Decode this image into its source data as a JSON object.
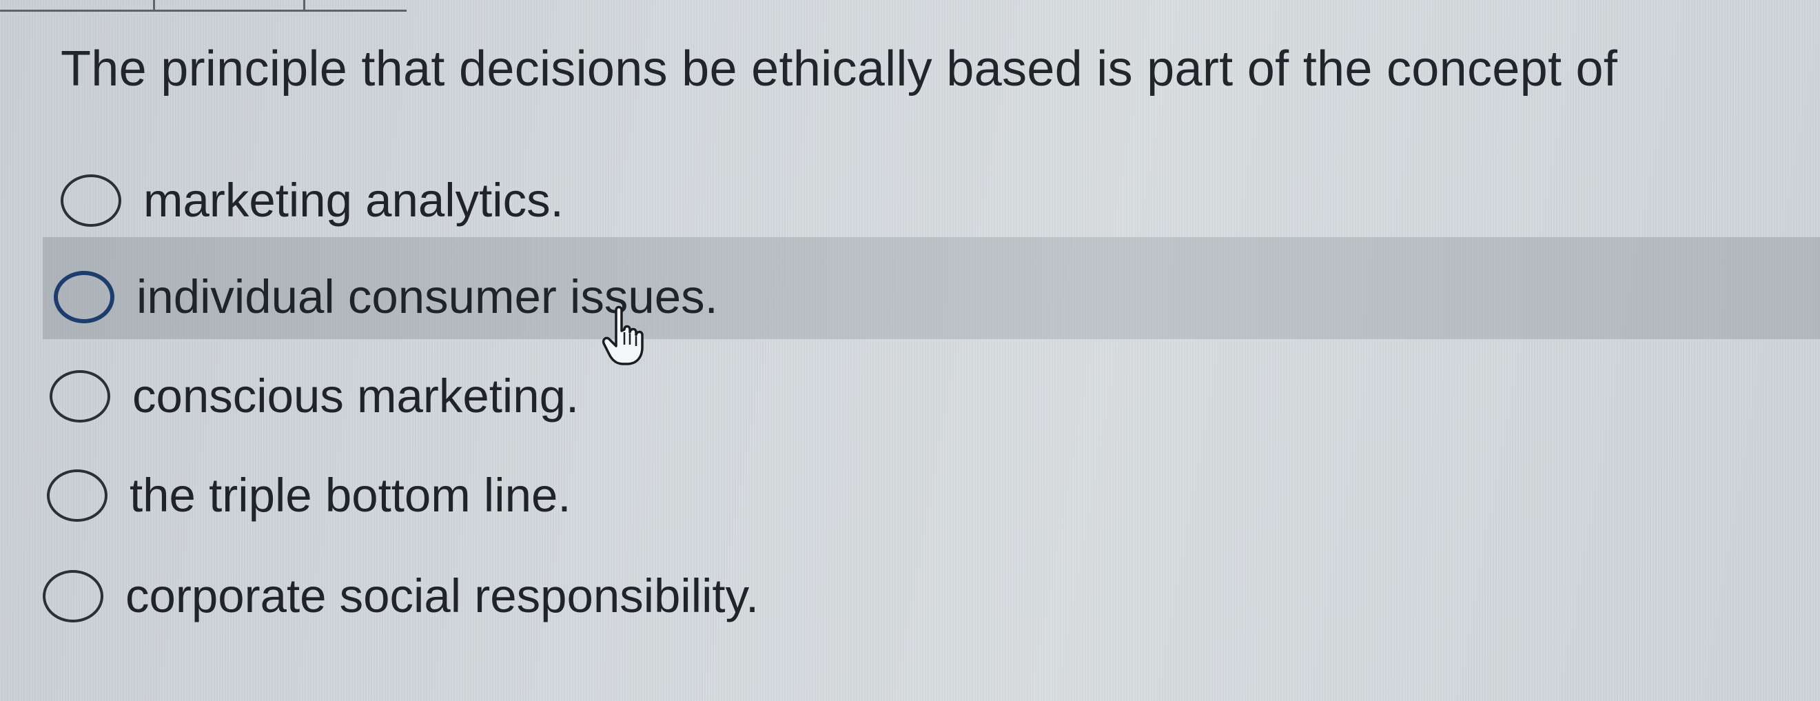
{
  "question": {
    "text": "The principle that decisions be ethically based is part of the concept of"
  },
  "options": [
    {
      "label": "marketing analytics.",
      "selected": false
    },
    {
      "label": "individual consumer issues.",
      "selected": false,
      "hovered": true
    },
    {
      "label": "conscious marketing.",
      "selected": false
    },
    {
      "label": "the triple bottom line.",
      "selected": false
    },
    {
      "label": "corporate social responsibility.",
      "selected": false
    }
  ],
  "cursor": {
    "icon": "hand-pointer-icon"
  },
  "colors": {
    "hover_band": "#9aa2a8",
    "hover_radio": "#1d3d6e",
    "text": "#202428"
  }
}
